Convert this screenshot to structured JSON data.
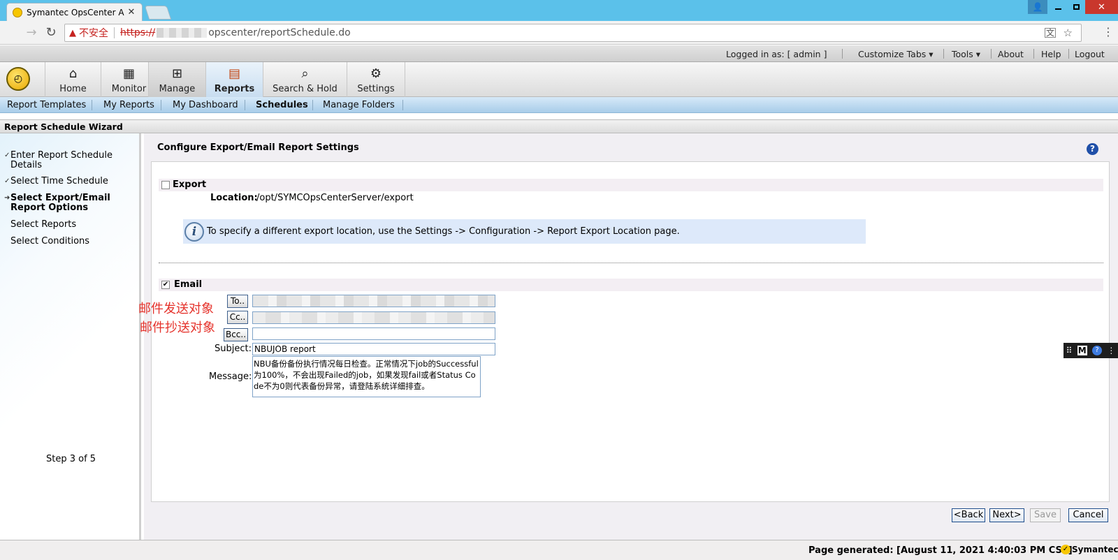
{
  "browser": {
    "tab_title": "Symantec OpsCenter A",
    "insecure_label": "不安全",
    "url_scheme": "https://",
    "url_path": "opscenter/reportSchedule.do"
  },
  "header": {
    "logged_in": "Logged in as: [ admin ]",
    "customize_tabs": "Customize Tabs",
    "tools": "Tools",
    "about": "About",
    "help": "Help",
    "logout": "Logout"
  },
  "tabs": {
    "home": "Home",
    "monitor": "Monitor",
    "manage": "Manage",
    "reports": "Reports",
    "search_hold": "Search & Hold",
    "settings": "Settings"
  },
  "subnav": {
    "templates": "Report Templates",
    "my_reports": "My Reports",
    "dashboard": "My Dashboard",
    "schedules": "Schedules",
    "folders": "Manage Folders"
  },
  "wizard": {
    "title": "Report Schedule Wizard",
    "steps": [
      "Enter Report Schedule Details",
      "Select Time Schedule",
      "Select Export/Email Report Options",
      "Select Reports",
      "Select Conditions"
    ],
    "step_indicator": "Step 3 of 5"
  },
  "main": {
    "section_title": "Configure Export/Email Report Settings",
    "export_label": "Export",
    "location_label": "Location:",
    "location_value": "/opt/SYMCOpsCenterServer/export",
    "info_text": "To specify a different export location, use the Settings -> Configuration -> Report Export Location page.",
    "email_label": "Email",
    "to_button": "To..",
    "cc_button": "Cc..",
    "bcc_button": "Bcc..",
    "subject_label": "Subject:",
    "subject_value": "NBUJOB report",
    "message_label": "Message:",
    "message_value": "NBU备份备份执行情况每日检查。正常情况下job的Successful为100%，不会出现Failed的job，如果发现fail或者Status Code不为0则代表备份异常，请登陆系统详细排查。"
  },
  "annotations": {
    "to": "邮件发送对象",
    "cc": "邮件抄送对象"
  },
  "buttons": {
    "back": "<Back",
    "next": "Next>",
    "save": "Save",
    "cancel": "Cancel"
  },
  "status": {
    "page_generated": "Page generated: [August 11, 2021 4:40:03 PM CST]",
    "brand": "Symantec."
  },
  "mini_toolbar": {
    "m": "M",
    "q": "?"
  }
}
